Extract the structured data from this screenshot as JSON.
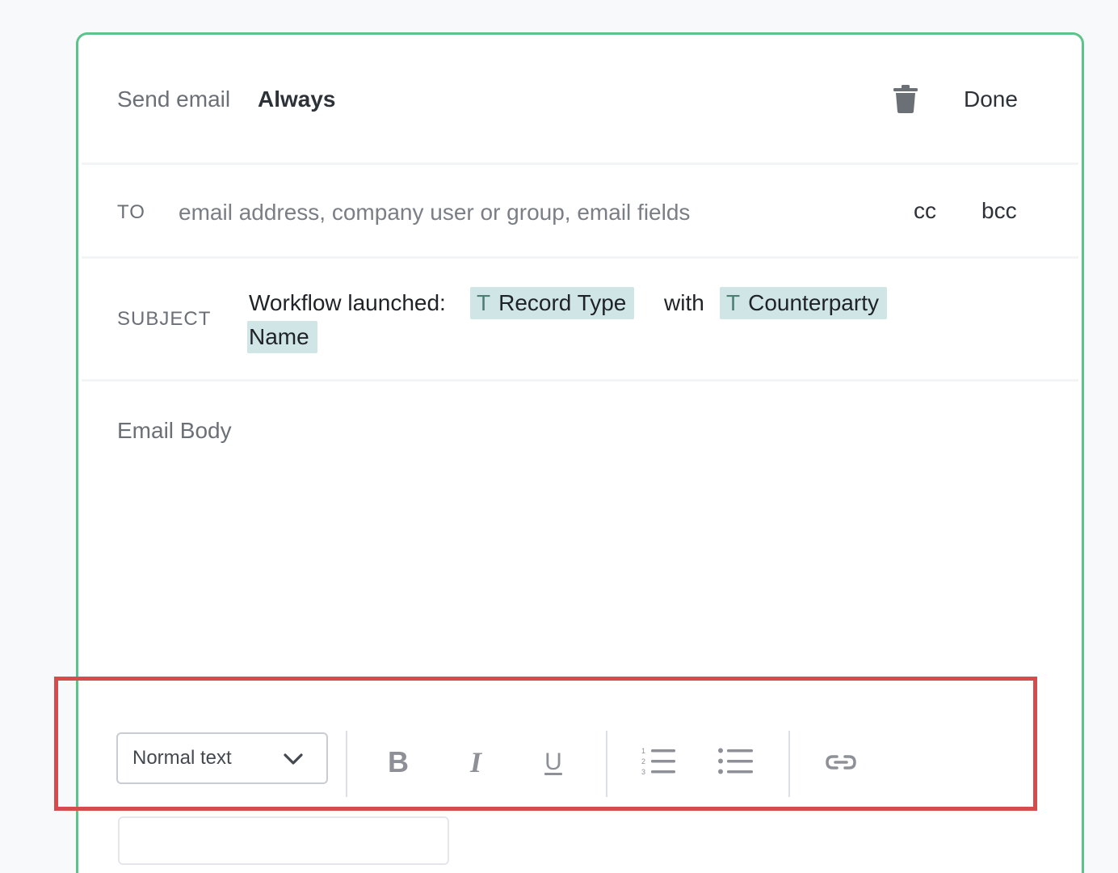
{
  "header": {
    "send_label": "Send email",
    "send_value": "Always",
    "done_label": "Done"
  },
  "to": {
    "label": "TO",
    "placeholder": "email address, company user or group, email fields",
    "cc_label": "cc",
    "bcc_label": "bcc"
  },
  "subject": {
    "label": "SUBJECT",
    "prefix": "Workflow launched:",
    "chip1": "Record Type",
    "middle": "with",
    "chip2_line1": "Counterparty",
    "chip2_line2": "Name",
    "chip_icon_glyph": "T"
  },
  "body": {
    "placeholder": "Email Body"
  },
  "toolbar": {
    "format_select_value": "Normal text",
    "bold_glyph": "B",
    "italic_glyph": "I",
    "underline_glyph": "U"
  },
  "colors": {
    "card_border": "#5ac48a",
    "highlight_border": "#d64c4c",
    "chip_bg": "#cfe5e6"
  },
  "icons": [
    "trash-icon",
    "chevron-down-icon",
    "bold-icon",
    "italic-icon",
    "underline-icon",
    "ordered-list-icon",
    "bullet-list-icon",
    "link-icon"
  ]
}
